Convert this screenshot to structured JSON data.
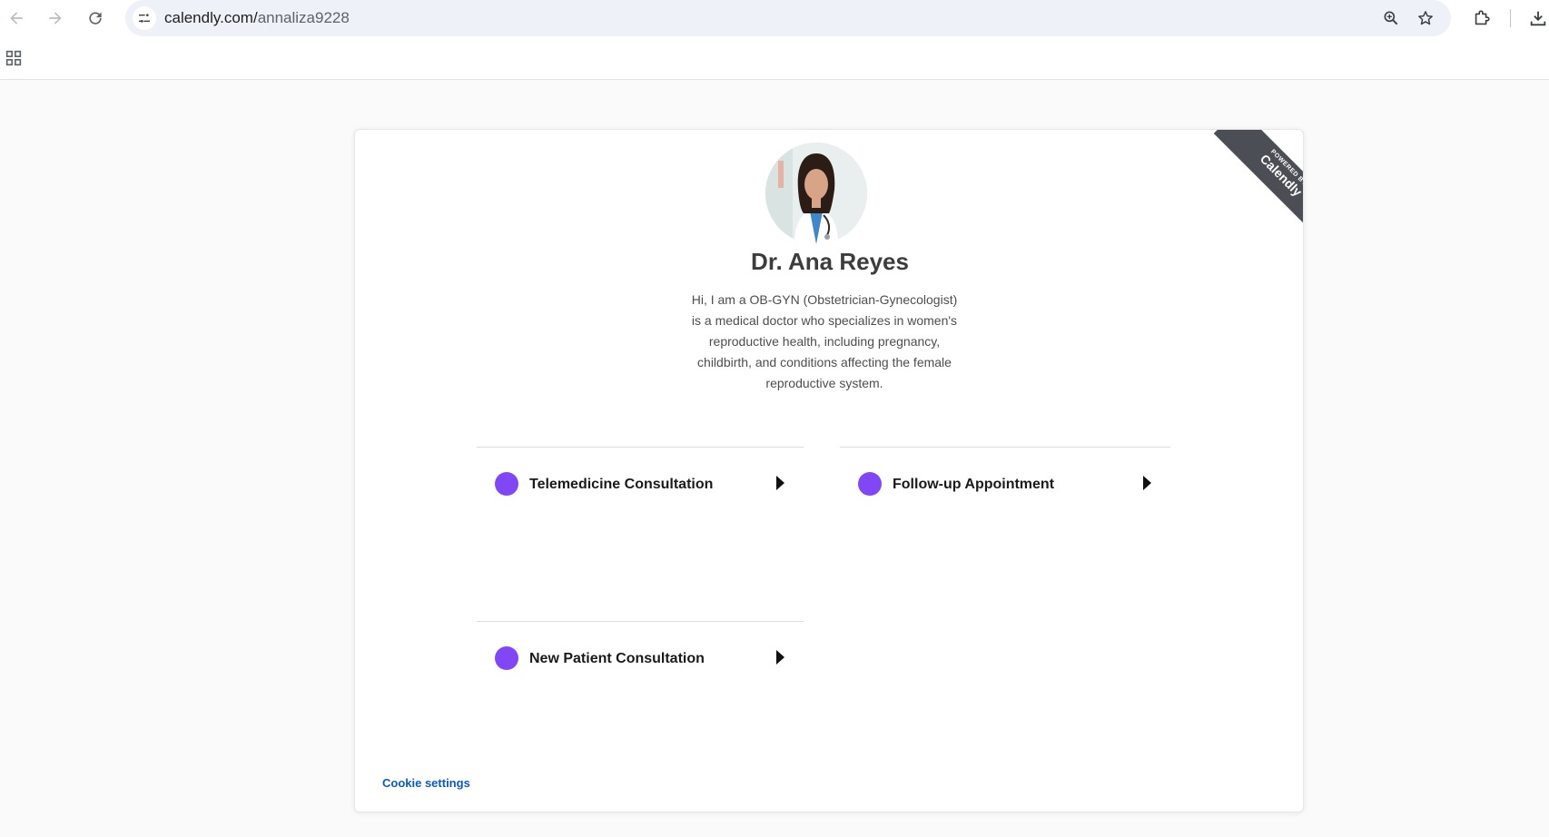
{
  "browser": {
    "url_host": "calendly.com/",
    "url_path": "annaliza9228",
    "icons": {
      "back": "arrow-left-icon",
      "forward": "arrow-right-icon",
      "reload": "reload-icon",
      "site_info": "tune-icon",
      "zoom": "zoom-icon",
      "bookmark": "star-icon",
      "extensions": "puzzle-icon",
      "download": "download-icon",
      "apps": "apps-grid-icon"
    }
  },
  "ribbon": {
    "small": "POWERED BY",
    "big": "Calendly"
  },
  "profile": {
    "name": "Dr. Ana Reyes",
    "bio": "Hi, I am a OB-GYN (Obstetrician-Gynecologist) is a medical doctor who specializes in women's reproductive health, including pregnancy, childbirth, and conditions affecting the female reproductive system."
  },
  "events": [
    {
      "label": "Telemedicine Consultation",
      "color": "#8247f5"
    },
    {
      "label": "Follow-up Appointment",
      "color": "#8247f5"
    },
    {
      "label": "New Patient Consultation",
      "color": "#8247f5"
    }
  ],
  "footer": {
    "cookie_label": "Cookie settings"
  },
  "colors": {
    "accent": "#8247f5",
    "link": "#0b5ac2",
    "ribbon": "#4b4f55"
  }
}
